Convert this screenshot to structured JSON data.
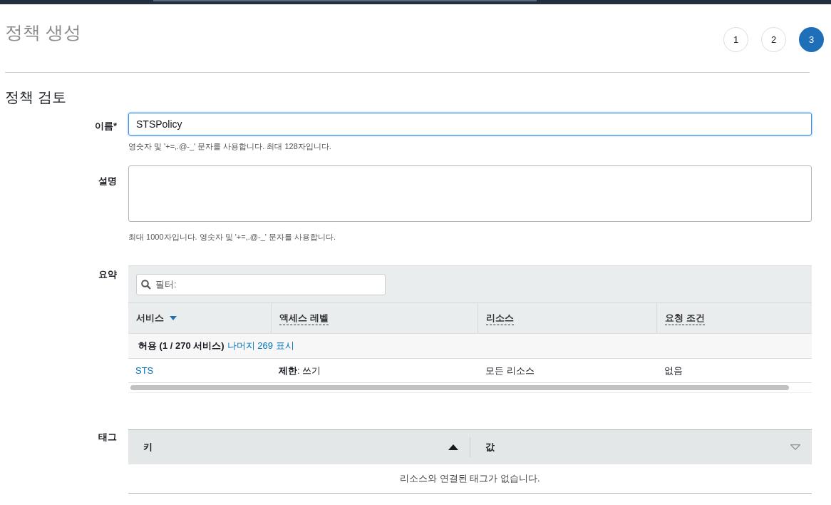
{
  "page_title": "정책 생성",
  "steps": [
    {
      "label": "1",
      "selected": false
    },
    {
      "label": "2",
      "selected": false
    },
    {
      "label": "3",
      "selected": true
    }
  ],
  "section_title": "정책 검토",
  "name_field": {
    "label": "이름*",
    "value": "STSPolicy",
    "focused": true,
    "hint": "영숫자 및 '+=,.@-_' 문자를 사용합니다. 최대 128자입니다."
  },
  "description_field": {
    "label": "설명",
    "hint": "최대 1000자입니다. 영숫자 및 '+=,.@-_' 문자를 사용합니다."
  },
  "summary": {
    "label": "요약",
    "filter": {
      "placeholder": "필터:"
    },
    "columns": [
      {
        "label": "서비스",
        "sorted": true
      },
      {
        "label": "액세스 레벨",
        "sorted": false
      },
      {
        "label": "리소스",
        "sorted": false
      },
      {
        "label": "요청 조건",
        "sorted": false
      }
    ],
    "group": {
      "label": "허용 (1 / 270 서비스)",
      "link": "나머지 269 표시"
    },
    "rows": [
      {
        "service": "STS",
        "access_level": "**제한**: 쓰기",
        "resource": "모든 리소스",
        "condition": "없음"
      }
    ]
  },
  "tags": {
    "label": "태그",
    "columns": [
      {
        "label": "키",
        "sort_active": true
      },
      {
        "label": "값",
        "sort_active": false
      }
    ],
    "empty_message": "리소스와 연결된 태그가 없습니다."
  }
}
